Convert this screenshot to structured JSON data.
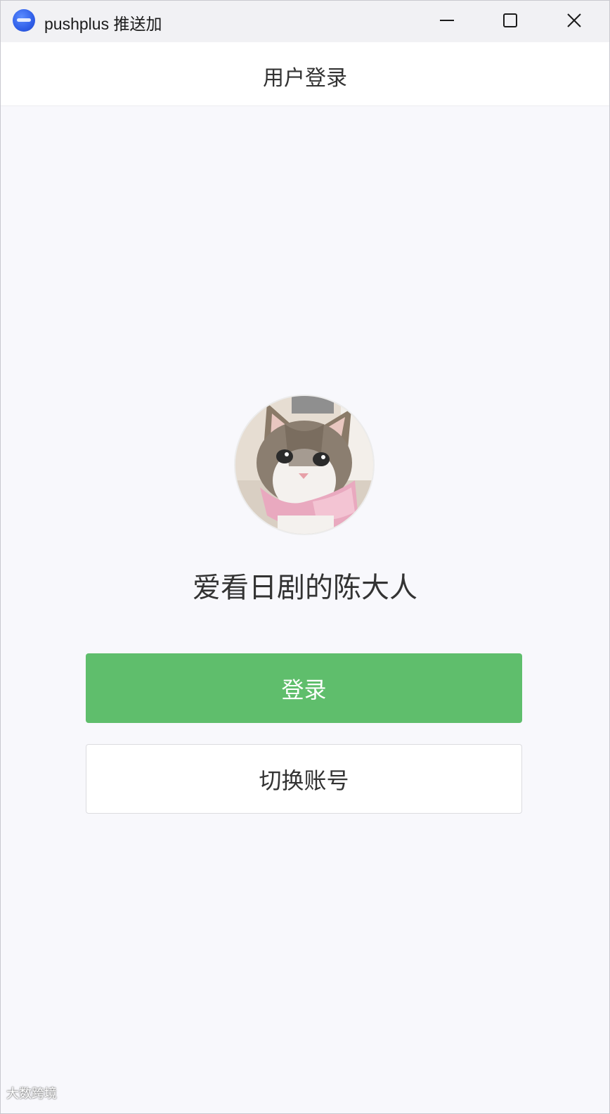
{
  "window": {
    "title": "pushplus 推送加",
    "app_icon": "pushplus-logo-icon",
    "controls": {
      "minimize_icon": "minimize-icon",
      "maximize_icon": "maximize-icon",
      "close_icon": "close-icon"
    }
  },
  "header": {
    "title": "用户登录"
  },
  "profile": {
    "avatar": "cat-avatar-image",
    "username": "爱看日剧的陈大人"
  },
  "actions": {
    "login_label": "登录",
    "switch_account_label": "切换账号"
  },
  "watermark": {
    "text": "大数跨境"
  },
  "colors": {
    "primary_green": "#5fbe6c",
    "app_blue": "#2f5ee8",
    "background": "#f8f8fc"
  }
}
